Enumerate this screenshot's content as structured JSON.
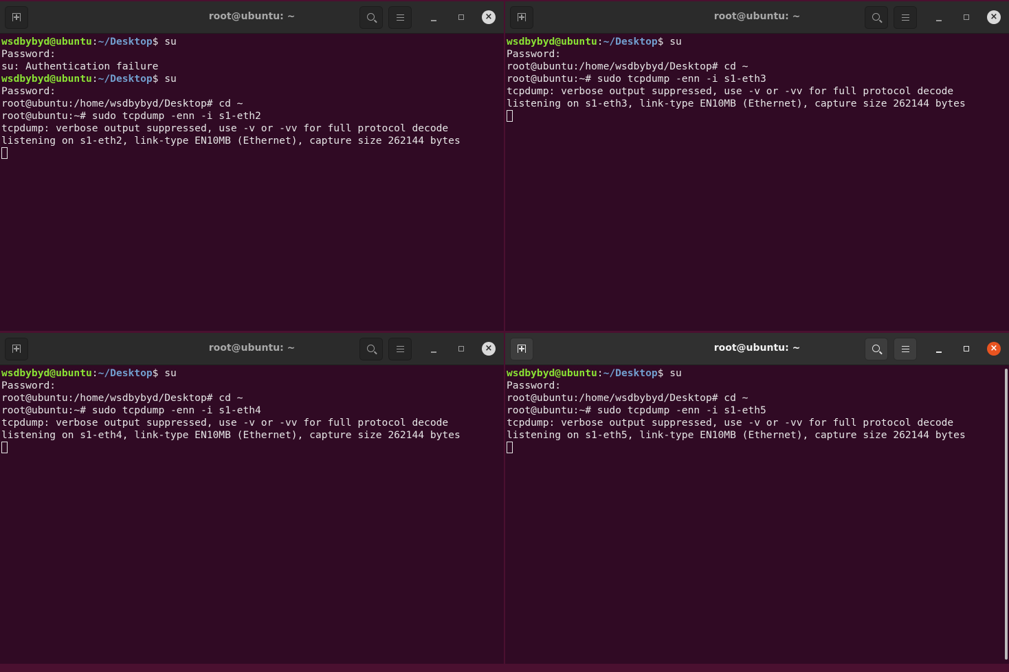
{
  "windows": [
    {
      "title": "root@ubuntu: ~",
      "focused": false,
      "lines": [
        {
          "user": "wsdbybyd@ubuntu",
          "path": "~/Desktop",
          "text": "$ su"
        },
        {
          "text": "Password:"
        },
        {
          "text": "su: Authentication failure"
        },
        {
          "user": "wsdbybyd@ubuntu",
          "path": "~/Desktop",
          "text": "$ su"
        },
        {
          "text": "Password:"
        },
        {
          "text": "root@ubuntu:/home/wsdbybyd/Desktop# cd ~"
        },
        {
          "text": "root@ubuntu:~# sudo tcpdump -enn -i s1-eth2"
        },
        {
          "text": "tcpdump: verbose output suppressed, use -v or -vv for full protocol decode"
        },
        {
          "text": "listening on s1-eth2, link-type EN10MB (Ethernet), capture size 262144 bytes"
        }
      ]
    },
    {
      "title": "root@ubuntu: ~",
      "focused": false,
      "lines": [
        {
          "user": "wsdbybyd@ubuntu",
          "path": "~/Desktop",
          "text": "$ su"
        },
        {
          "text": "Password:"
        },
        {
          "text": "root@ubuntu:/home/wsdbybyd/Desktop# cd ~"
        },
        {
          "text": "root@ubuntu:~# sudo tcpdump -enn -i s1-eth3"
        },
        {
          "text": "tcpdump: verbose output suppressed, use -v or -vv for full protocol decode"
        },
        {
          "text": "listening on s1-eth3, link-type EN10MB (Ethernet), capture size 262144 bytes"
        }
      ]
    },
    {
      "title": "root@ubuntu: ~",
      "focused": false,
      "lines": [
        {
          "user": "wsdbybyd@ubuntu",
          "path": "~/Desktop",
          "text": "$ su"
        },
        {
          "text": "Password:"
        },
        {
          "text": "root@ubuntu:/home/wsdbybyd/Desktop# cd ~"
        },
        {
          "text": "root@ubuntu:~# sudo tcpdump -enn -i s1-eth4"
        },
        {
          "text": "tcpdump: verbose output suppressed, use -v or -vv for full protocol decode"
        },
        {
          "text": "listening on s1-eth4, link-type EN10MB (Ethernet), capture size 262144 bytes"
        }
      ]
    },
    {
      "title": "root@ubuntu: ~",
      "focused": true,
      "lines": [
        {
          "user": "wsdbybyd@ubuntu",
          "path": "~/Desktop",
          "text": "$ su"
        },
        {
          "text": "Password:"
        },
        {
          "text": "root@ubuntu:/home/wsdbybyd/Desktop# cd ~"
        },
        {
          "text": "root@ubuntu:~# sudo tcpdump -enn -i s1-eth5"
        },
        {
          "text": "tcpdump: verbose output suppressed, use -v or -vv for full protocol decode"
        },
        {
          "text": "listening on s1-eth5, link-type EN10MB (Ethernet), capture size 262144 bytes"
        }
      ]
    }
  ],
  "icons": {
    "new_tab": "new-tab-icon",
    "search": "search-icon",
    "menu": "hamburger-menu-icon",
    "minimize": "minimize-icon",
    "maximize": "maximize-icon",
    "close": "close-icon"
  },
  "colors": {
    "terminal_bg": "#300a24",
    "prompt_user": "#8ae234",
    "prompt_path": "#729fcf",
    "text": "#e6e6e6",
    "close_focused": "#e95420",
    "titlebar": "#303030"
  }
}
